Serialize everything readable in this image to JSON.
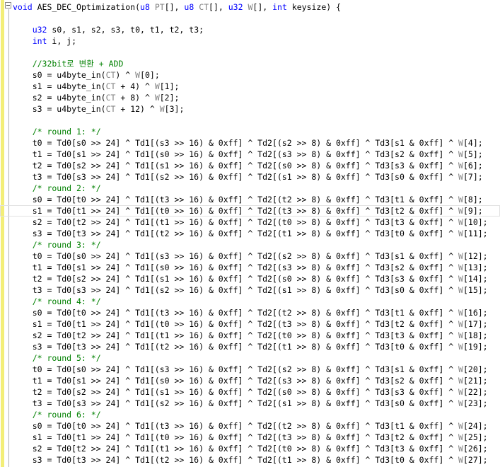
{
  "editor": {
    "current_line_index": 18,
    "lines": [
      "void AES_DEC_Optimization(u8 PT[], u8 CT[], u32 W[], int keysize) {",
      "",
      "    u32 s0, s1, s2, s3, t0, t1, t2, t3;",
      "    int i, j;",
      "",
      "    //32bit로 변환 + ADD",
      "    s0 = u4byte_in(CT) ^ W[0];",
      "    s1 = u4byte_in(CT + 4) ^ W[1];",
      "    s2 = u4byte_in(CT + 8) ^ W[2];",
      "    s3 = u4byte_in(CT + 12) ^ W[3];",
      "",
      "    /* round 1: */",
      "    t0 = Td0[s0 >> 24] ^ Td1[(s3 >> 16) & 0xff] ^ Td2[(s2 >> 8) & 0xff] ^ Td3[s1 & 0xff] ^ W[4];",
      "    t1 = Td0[s1 >> 24] ^ Td1[(s0 >> 16) & 0xff] ^ Td2[(s3 >> 8) & 0xff] ^ Td3[s2 & 0xff] ^ W[5];",
      "    t2 = Td0[s2 >> 24] ^ Td1[(s1 >> 16) & 0xff] ^ Td2[(s0 >> 8) & 0xff] ^ Td3[s3 & 0xff] ^ W[6];",
      "    t3 = Td0[s3 >> 24] ^ Td1[(s2 >> 16) & 0xff] ^ Td2[(s1 >> 8) & 0xff] ^ Td3[s0 & 0xff] ^ W[7];",
      "    /* round 2: */",
      "    s0 = Td0[t0 >> 24] ^ Td1[(t3 >> 16) & 0xff] ^ Td2[(t2 >> 8) & 0xff] ^ Td3[t1 & 0xff] ^ W[8];",
      "    s1 = Td0[t1 >> 24] ^ Td1[(t0 >> 16) & 0xff] ^ Td2[(t3 >> 8) & 0xff] ^ Td3[t2 & 0xff] ^ W[9];",
      "    s2 = Td0[t2 >> 24] ^ Td1[(t1 >> 16) & 0xff] ^ Td2[(t0 >> 8) & 0xff] ^ Td3[t3 & 0xff] ^ W[10];",
      "    s3 = Td0[t3 >> 24] ^ Td1[(t2 >> 16) & 0xff] ^ Td2[(t1 >> 8) & 0xff] ^ Td3[t0 & 0xff] ^ W[11];",
      "    /* round 3: */",
      "    t0 = Td0[s0 >> 24] ^ Td1[(s3 >> 16) & 0xff] ^ Td2[(s2 >> 8) & 0xff] ^ Td3[s1 & 0xff] ^ W[12];",
      "    t1 = Td0[s1 >> 24] ^ Td1[(s0 >> 16) & 0xff] ^ Td2[(s3 >> 8) & 0xff] ^ Td3[s2 & 0xff] ^ W[13];",
      "    t2 = Td0[s2 >> 24] ^ Td1[(s1 >> 16) & 0xff] ^ Td2[(s0 >> 8) & 0xff] ^ Td3[s3 & 0xff] ^ W[14];",
      "    t3 = Td0[s3 >> 24] ^ Td1[(s2 >> 16) & 0xff] ^ Td2[(s1 >> 8) & 0xff] ^ Td3[s0 & 0xff] ^ W[15];",
      "    /* round 4: */",
      "    s0 = Td0[t0 >> 24] ^ Td1[(t3 >> 16) & 0xff] ^ Td2[(t2 >> 8) & 0xff] ^ Td3[t1 & 0xff] ^ W[16];",
      "    s1 = Td0[t1 >> 24] ^ Td1[(t0 >> 16) & 0xff] ^ Td2[(t3 >> 8) & 0xff] ^ Td3[t2 & 0xff] ^ W[17];",
      "    s2 = Td0[t2 >> 24] ^ Td1[(t1 >> 16) & 0xff] ^ Td2[(t0 >> 8) & 0xff] ^ Td3[t3 & 0xff] ^ W[18];",
      "    s3 = Td0[t3 >> 24] ^ Td1[(t2 >> 16) & 0xff] ^ Td2[(t1 >> 8) & 0xff] ^ Td3[t0 & 0xff] ^ W[19];",
      "    /* round 5: */",
      "    t0 = Td0[s0 >> 24] ^ Td1[(s3 >> 16) & 0xff] ^ Td2[(s2 >> 8) & 0xff] ^ Td3[s1 & 0xff] ^ W[20];",
      "    t1 = Td0[s1 >> 24] ^ Td1[(s0 >> 16) & 0xff] ^ Td2[(s3 >> 8) & 0xff] ^ Td3[s2 & 0xff] ^ W[21];",
      "    t2 = Td0[s2 >> 24] ^ Td1[(s1 >> 16) & 0xff] ^ Td2[(s0 >> 8) & 0xff] ^ Td3[s3 & 0xff] ^ W[22];",
      "    t3 = Td0[s3 >> 24] ^ Td1[(s2 >> 16) & 0xff] ^ Td2[(s1 >> 8) & 0xff] ^ Td3[s0 & 0xff] ^ W[23];",
      "    /* round 6: */",
      "    s0 = Td0[t0 >> 24] ^ Td1[(t3 >> 16) & 0xff] ^ Td2[(t2 >> 8) & 0xff] ^ Td3[t1 & 0xff] ^ W[24];",
      "    s1 = Td0[t1 >> 24] ^ Td1[(t0 >> 16) & 0xff] ^ Td2[(t3 >> 8) & 0xff] ^ Td3[t2 & 0xff] ^ W[25];",
      "    s2 = Td0[t2 >> 24] ^ Td1[(t1 >> 16) & 0xff] ^ Td2[(t0 >> 8) & 0xff] ^ Td3[t3 & 0xff] ^ W[26];",
      "    s3 = Td0[t3 >> 24] ^ Td1[(t2 >> 16) & 0xff] ^ Td2[(t1 >> 8) & 0xff] ^ Td3[t0 & 0xff] ^ W[27];"
    ]
  },
  "colors": {
    "keyword": "#0000ff",
    "comment": "#008000",
    "text": "#000000",
    "dim": "#808080",
    "change_bar": "#f3ee77"
  },
  "icons": {
    "fold_toggle": "collapse-minus-icon"
  }
}
